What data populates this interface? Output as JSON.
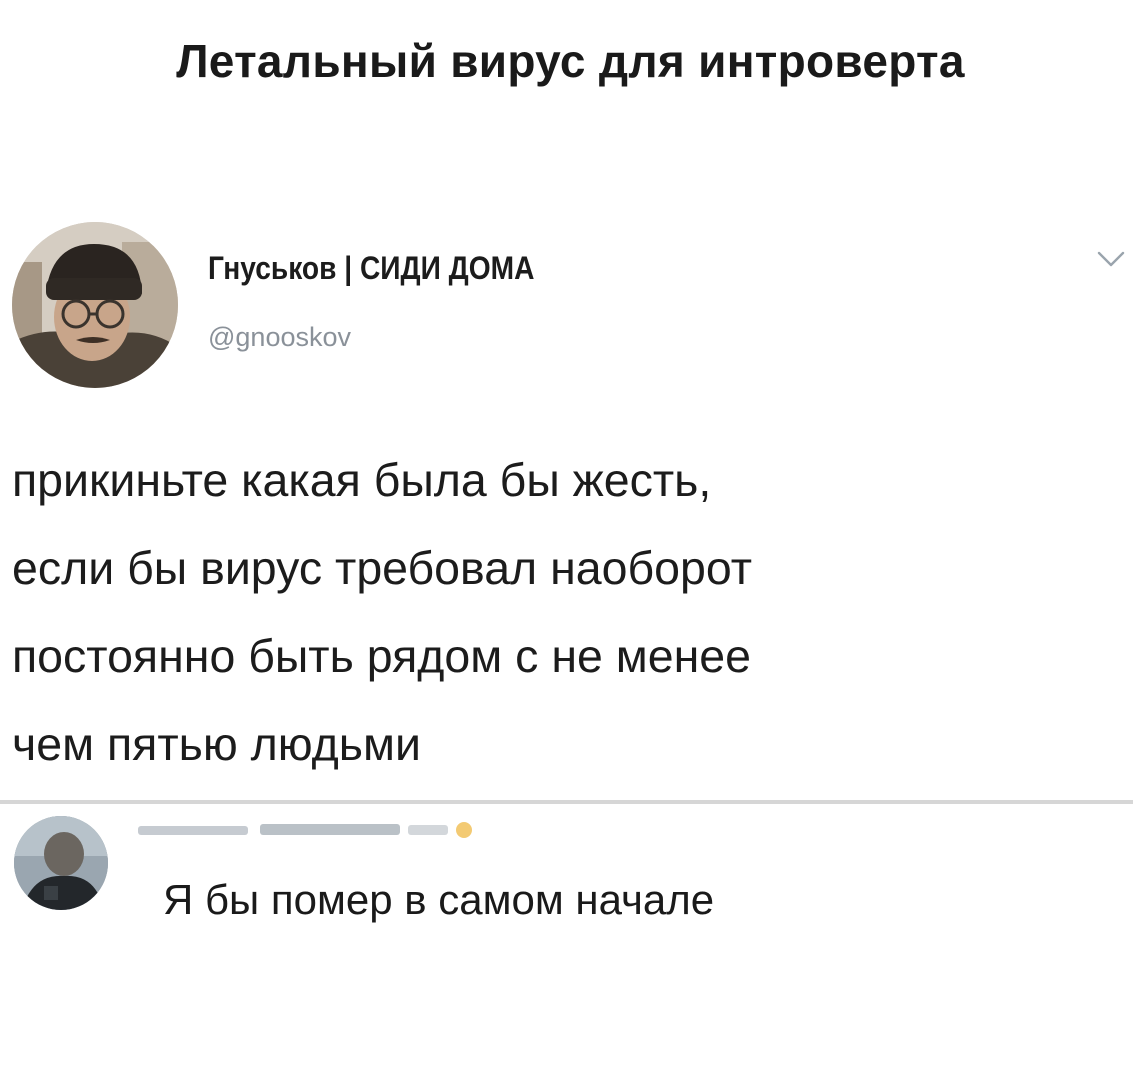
{
  "meme": {
    "title": "Летальный вирус для интроверта"
  },
  "tweet": {
    "author_name": "Гнуськов | СИДИ ДОМА",
    "author_handle": "@gnooskov",
    "avatar_icon": "user-avatar-photo",
    "menu_icon": "chevron-down-icon",
    "text_lines": [
      "прикиньте какая была бы жесть,",
      "если бы вирус требовал наоборот",
      "постоянно быть рядом с не менее",
      "чем пятью людьми"
    ]
  },
  "comment": {
    "avatar_icon": "user-avatar-photo",
    "text": "Я бы помер в самом начале"
  },
  "colors": {
    "handle": "#8a9199",
    "divider": "#d6d6d6",
    "chevron": "#9aa4ad"
  }
}
